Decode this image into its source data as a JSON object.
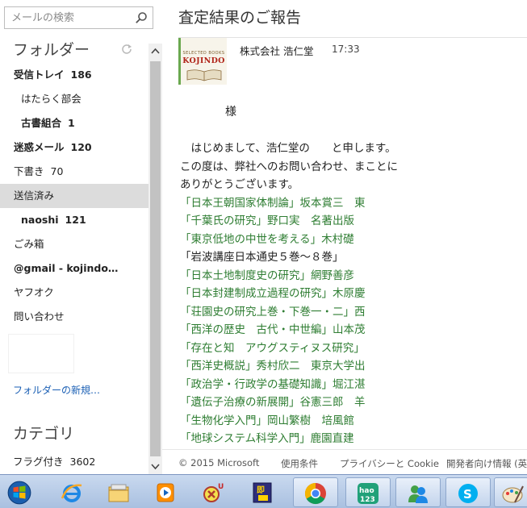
{
  "search": {
    "placeholder": "メールの検索"
  },
  "folders": {
    "header": "フォルダー",
    "items": [
      {
        "label": "受信トレイ",
        "count": "186",
        "bold": true,
        "level": 0,
        "selected": false
      },
      {
        "label": "はたらく部会",
        "count": "",
        "bold": false,
        "level": 1,
        "selected": false
      },
      {
        "label": "古書組合",
        "count": "1",
        "bold": true,
        "level": 1,
        "selected": false
      },
      {
        "label": "迷惑メール",
        "count": "120",
        "bold": true,
        "level": 0,
        "selected": false
      },
      {
        "label": "下書き",
        "count": "70",
        "bold": false,
        "level": 0,
        "selected": false
      },
      {
        "label": "送信済み",
        "count": "",
        "bold": false,
        "level": 0,
        "selected": true
      },
      {
        "label": "naoshi",
        "count": "121",
        "bold": true,
        "level": 1,
        "selected": false
      },
      {
        "label": "ごみ箱",
        "count": "",
        "bold": false,
        "level": 0,
        "selected": false
      },
      {
        "label": "@gmail - kojindo…",
        "count": "",
        "bold": true,
        "level": 0,
        "selected": false
      },
      {
        "label": "ヤフオク",
        "count": "",
        "bold": false,
        "level": 0,
        "selected": false
      },
      {
        "label": "問い合わせ",
        "count": "",
        "bold": false,
        "level": 0,
        "selected": false
      }
    ],
    "new_folder": "フォルダーの新規…"
  },
  "categories": {
    "header": "カテゴリ",
    "flagged_label": "フラグ付き",
    "flagged_count": "3602"
  },
  "message": {
    "subject": "査定結果のご報告",
    "sender": "株式会社 浩仁堂",
    "time": "17:33",
    "logo_tagline": "SELECTED BOOKS",
    "logo_name": "KOJINDO",
    "salutation": "様",
    "intro": [
      "　はじめまして、浩仁堂の　　と申します。",
      "この度は、弊社へのお問い合わせ、まことに",
      "ありがとうございます。"
    ],
    "books": [
      {
        "text": "「日本王朝国家体制論」坂本賞三　東",
        "green": true
      },
      {
        "text": "「千葉氏の研究」野口実　名著出版",
        "green": true
      },
      {
        "text": "「東京低地の中世を考える」木村礎",
        "green": true
      },
      {
        "text": "「岩波講座日本通史５巻～８巻」",
        "green": false
      },
      {
        "text": "「日本土地制度史の研究」網野善彦",
        "green": true
      },
      {
        "text": "「日本封建制成立過程の研究」木原慶",
        "green": true
      },
      {
        "text": "「荘園史の研究上巻・下巻一・二」西",
        "green": true
      },
      {
        "text": "「西洋の歴史　古代・中世編」山本茂",
        "green": true
      },
      {
        "text": "「存在と知　アウグスティヌス研究」",
        "green": true
      },
      {
        "text": "「西洋史概説」秀村欣二　東京大学出",
        "green": true
      },
      {
        "text": "「政治学・行政学の基礎知識」堀江湛",
        "green": true
      },
      {
        "text": "「遺伝子治療の新展開」谷憲三郎　羊",
        "green": true
      },
      {
        "text": "「生物化学入門」岡山繁樹　培風館",
        "green": true
      },
      {
        "text": "「地球システム科学入門」鹿園直建",
        "green": true
      }
    ]
  },
  "footer": {
    "copyright": "© 2015 Microsoft",
    "terms": "使用条件",
    "privacy": "プライバシーと Cookie",
    "developers": "開発者向け情報 (英"
  },
  "taskbar": {
    "icons": [
      "start-orb-icon",
      "internet-explorer-icon",
      "file-explorer-icon",
      "media-player-icon",
      "game-app-icon",
      "kojindo-app-icon",
      "chrome-icon",
      "hao123-icon",
      "messenger-icon",
      "skype-icon",
      "paint-icon"
    ],
    "hao_label": "hao 123",
    "kojindo_label": "即"
  }
}
